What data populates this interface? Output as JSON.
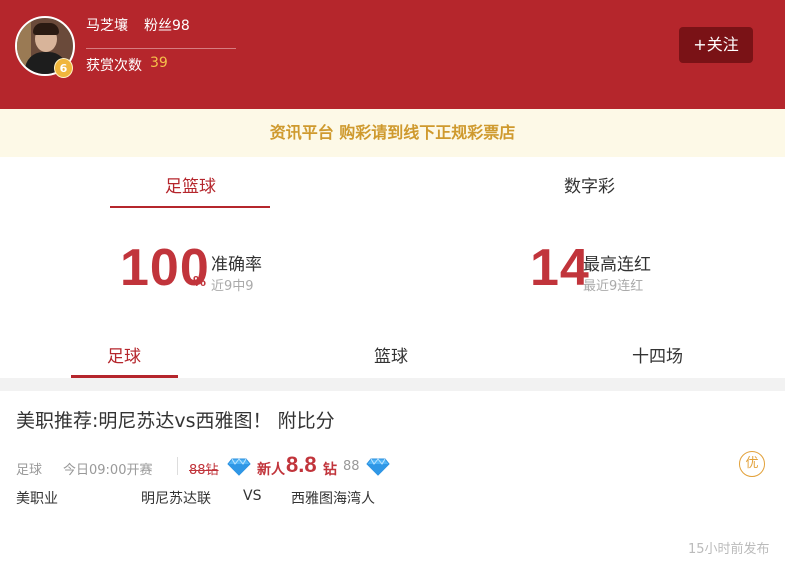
{
  "profile": {
    "name": "马芝壤",
    "fans": "粉丝98",
    "level": "6",
    "reward_label": "获赏次数",
    "reward_count": "39",
    "follow_label": "+关注"
  },
  "notice": "资讯平台 购彩请到线下正规彩票店",
  "category_tabs": [
    {
      "label": "足篮球",
      "active": true
    },
    {
      "label": "数字彩",
      "active": false
    }
  ],
  "stats": {
    "accuracy": {
      "value": "100",
      "unit": "%",
      "title": "准确率",
      "sub": "近9中9"
    },
    "streak": {
      "value": "14",
      "title": "最高连红",
      "sub": "最近9连红"
    }
  },
  "sport_tabs": [
    {
      "label": "足球",
      "active": true
    },
    {
      "label": "篮球",
      "active": false
    },
    {
      "label": "十四场",
      "active": false
    }
  ],
  "article": {
    "title": "美职推荐:明尼苏达vs西雅图！ 附比分",
    "sport": "足球",
    "time": "今日09:00开赛",
    "old_price": "88钻",
    "new_label": "新人",
    "new_price": "8.8",
    "diamond_unit": "钻",
    "vip_price": "88",
    "badge": "优",
    "league": "美职业",
    "home": "明尼苏达联",
    "vs": "VS",
    "away": "西雅图海湾人",
    "published": "15小时前发布"
  },
  "colors": {
    "brand": "#b5262c",
    "accent_gold": "#cf9a2e",
    "diamond": "#3fa4f0"
  }
}
